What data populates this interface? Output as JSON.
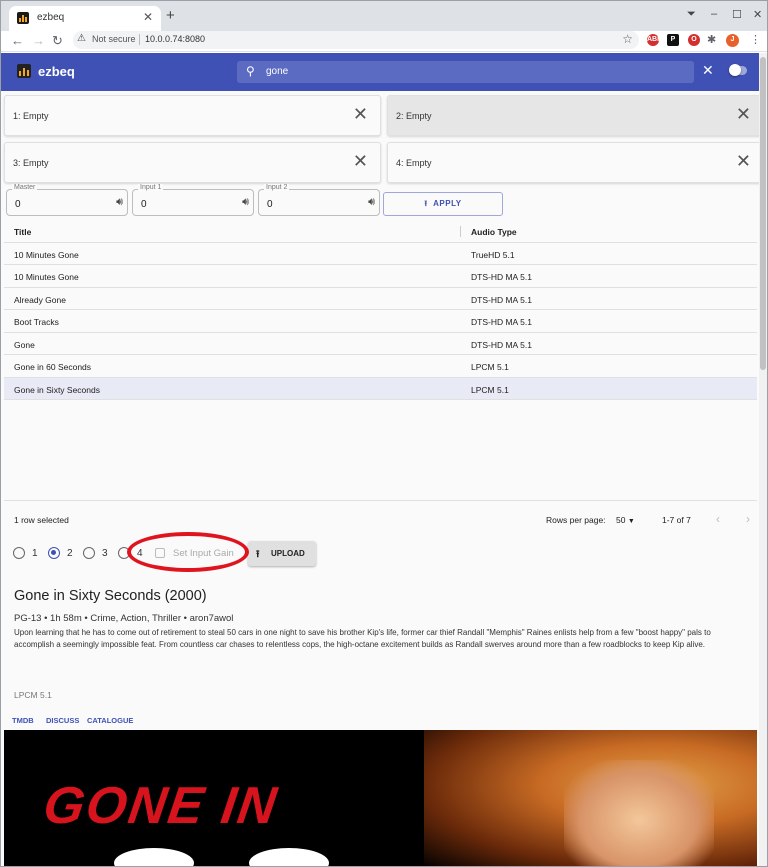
{
  "browser": {
    "tab_title": "ezbeq",
    "tab_close": "✕",
    "new_tab": "+",
    "security_label": "Not secure",
    "url": "10.0.0.74:8080",
    "profile_initial": "J",
    "extensions": [
      "ABP",
      "P",
      "O"
    ]
  },
  "app": {
    "name": "ezbeq",
    "search_value": "gone",
    "clear_icon": "✕"
  },
  "slots": [
    {
      "label": "1: Empty",
      "selected": false
    },
    {
      "label": "2: Empty",
      "selected": true
    },
    {
      "label": "3: Empty",
      "selected": false
    },
    {
      "label": "4: Empty",
      "selected": false
    }
  ],
  "gains": [
    {
      "caption": "Master",
      "value": "0"
    },
    {
      "caption": "Input 1",
      "value": "0"
    },
    {
      "caption": "Input 2",
      "value": "0"
    }
  ],
  "apply_label": "APPLY",
  "table": {
    "headers": [
      "Title",
      "Audio Type"
    ],
    "rows": [
      {
        "title": "10 Minutes Gone",
        "audio": "TrueHD 5.1"
      },
      {
        "title": "10 Minutes Gone",
        "audio": "DTS-HD MA 5.1"
      },
      {
        "title": "Already Gone",
        "audio": "DTS-HD MA 5.1"
      },
      {
        "title": "Boot Tracks",
        "audio": "DTS-HD MA 5.1"
      },
      {
        "title": "Gone",
        "audio": "DTS-HD MA 5.1"
      },
      {
        "title": "Gone in 60 Seconds",
        "audio": "LPCM 5.1"
      },
      {
        "title": "Gone in Sixty Seconds",
        "audio": "LPCM 5.1"
      }
    ],
    "selected_row": 6
  },
  "footer": {
    "rows_selected": "1 row selected",
    "rows_per_page_label": "Rows per page:",
    "rows_per_page_value": "50",
    "range": "1-7 of 7"
  },
  "upload_controls": {
    "slot_options": [
      "1",
      "2",
      "3",
      "4"
    ],
    "selected_slot": "2",
    "set_input_gain_label": "Set Input Gain",
    "upload_label": "UPLOAD"
  },
  "details": {
    "title": "Gone in Sixty Seconds (2000)",
    "meta": "PG-13 • 1h 58m • Crime, Action, Thriller • aron7awol",
    "description": "Upon learning that he has to come out of retirement to steal 50 cars in one night to save his brother Kip's life, former car thief Randall \"Memphis\" Raines enlists help from a few \"boost happy\" pals to accomplish a seemingly impossible feat. From countless car chases to relentless cops, the high-octane excitement builds as Randall swerves around more than a few roadblocks to keep Kip alive.",
    "audio_type": "LPCM 5.1",
    "links": [
      "TMDB",
      "DISCUSS",
      "CATALOGUE"
    ],
    "poster_text": "GONE IN"
  },
  "colors": {
    "primary": "#3f51b5",
    "annotation": "#e0141e"
  }
}
